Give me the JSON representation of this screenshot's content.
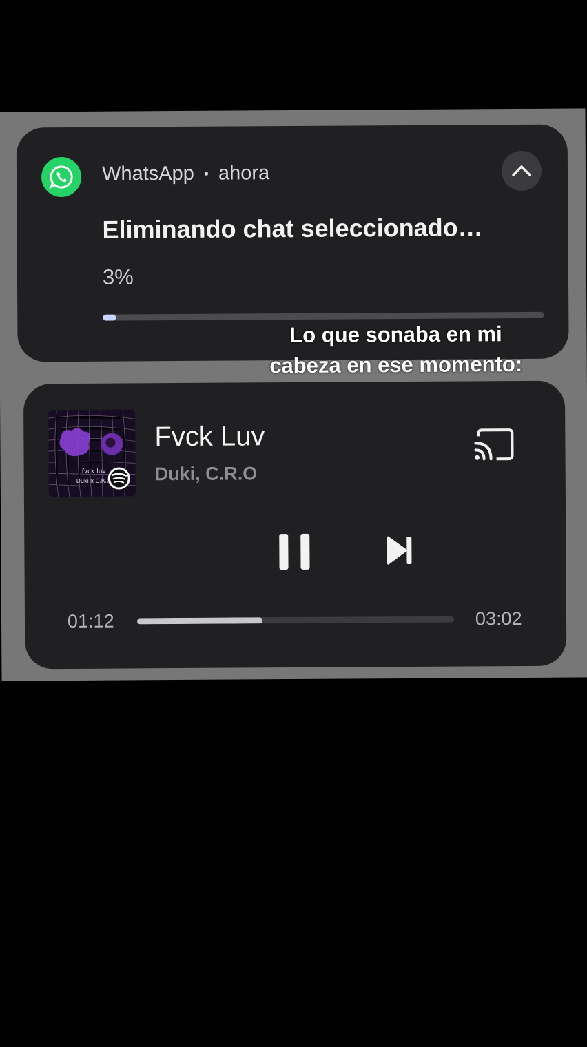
{
  "notification": {
    "app_name": "WhatsApp",
    "separator": "•",
    "time": "ahora",
    "title": "Eliminando chat seleccionado…",
    "progress_label": "3%",
    "progress": 0.03,
    "icon": "whatsapp-icon",
    "expand_icon": "chevron-up-icon",
    "accent_color": "#25D366"
  },
  "caption": {
    "line1": "Lo que sonaba en mi",
    "line2": "cabeza en ese momento:"
  },
  "media": {
    "title": "Fvck Luv",
    "artist": "Duki, C.R.O",
    "elapsed": "01:12",
    "duration": "03:02",
    "progress": 0.395,
    "album_art_text_1": "fvck luv",
    "album_art_text_2": "Duki x C.R.O",
    "source_icon": "spotify-icon",
    "cast_icon": "cast-icon",
    "pause_icon": "pause-icon",
    "next_icon": "skip-next-icon"
  }
}
